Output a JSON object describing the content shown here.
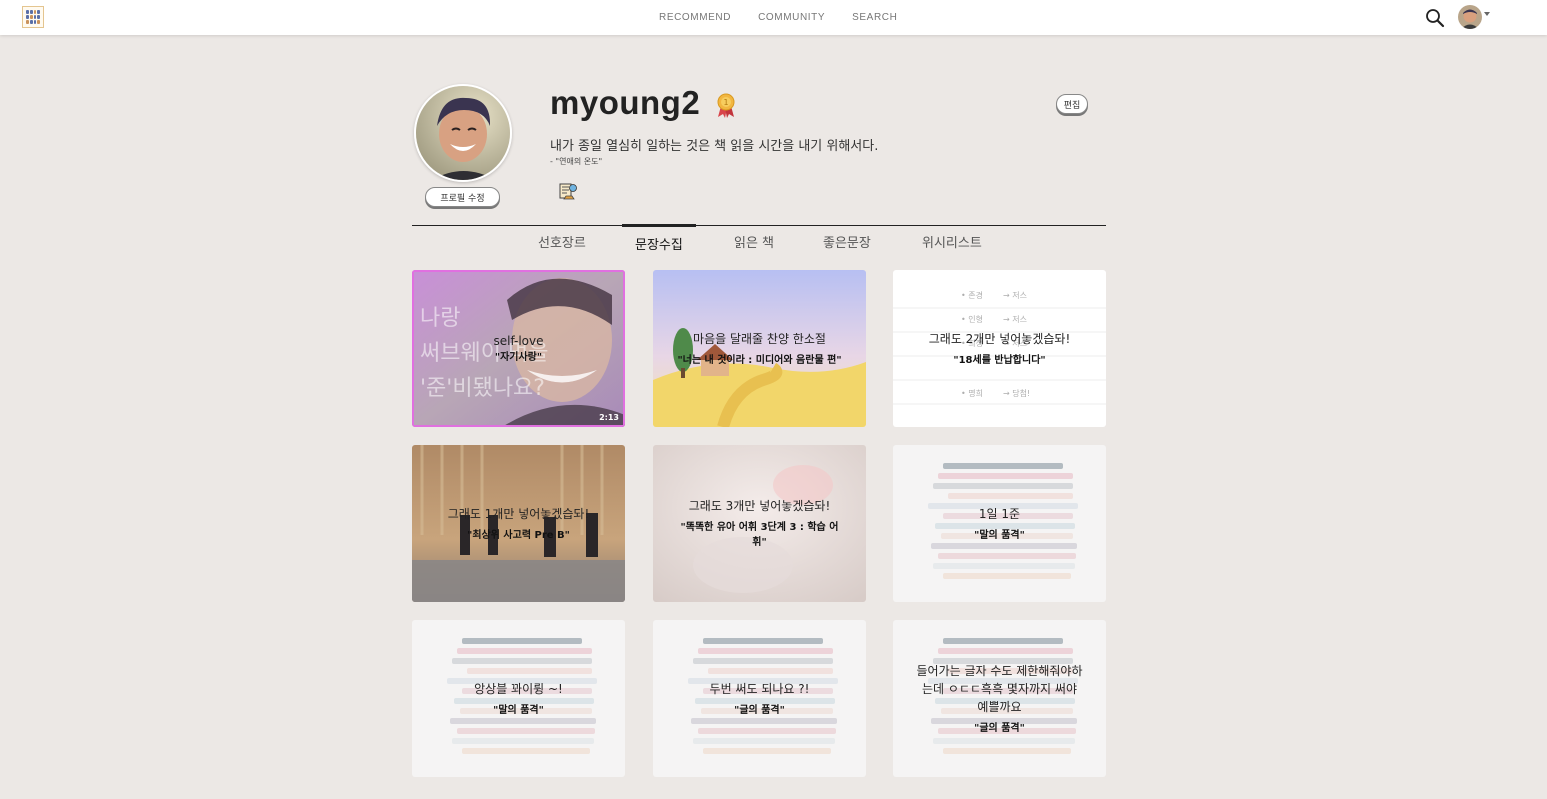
{
  "nav": {
    "links": [
      "RECOMMEND",
      "COMMUNITY",
      "SEARCH"
    ]
  },
  "profile": {
    "username": "myoung2",
    "quote": "내가 종일 열심히 일하는 것은 책 읽을 시간을 내기 위해서다.",
    "quote_source": "- \"연애의 온도\"",
    "edit_profile_label": "프로필 수정",
    "edit_label": "편집"
  },
  "tabs": [
    "선호장르",
    "문장수집",
    "읽은 책",
    "좋은문장",
    "위시리스트"
  ],
  "active_tab": "문장수집",
  "cards": [
    {
      "title": "self-love",
      "book": "\"자기사랑\"",
      "duration": "2:13"
    },
    {
      "title": "마음을 달래줄 찬양 한소절",
      "book": "\"너는 내 것이라 : 미디어와 음란물 편\""
    },
    {
      "title": "그래도 2개만 넣어놓겠습돠!",
      "book": "\"18세를 반납합니다\""
    },
    {
      "title": "그래도 1개만 넣어놓겠습돠!",
      "book": "\"최상위 사고력 Pre B\""
    },
    {
      "title": "그래도 3개만 넣어놓겠습돠!",
      "book": "\"똑똑한 유아 어휘 3단계 3 : 학습 어휘\""
    },
    {
      "title": "1일 1준",
      "book": "\"말의 품격\""
    },
    {
      "title": "앙상블 꽈이륑 ~!",
      "book": "\"말의 품격\""
    },
    {
      "title": "두번 써도 되나요 ?!",
      "book": "\"글의 품격\""
    },
    {
      "title": "들어가는 글자 수도 제한해줘야하는데 ㅇㄷㄷ흑흑 몇자까지 써야 예쁠까요",
      "book": "\"글의 품격\""
    }
  ],
  "colors": {
    "page_bg": "#ece8e5",
    "tab_line": "#222222"
  }
}
